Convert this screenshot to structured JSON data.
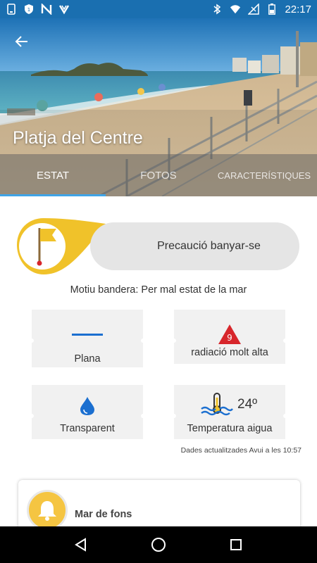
{
  "status_bar": {
    "time": "22:17",
    "left_icons": [
      "phone-icon",
      "shield-icon",
      "n-icon",
      "check-icon"
    ],
    "right_icons": [
      "bluetooth-icon",
      "wifi-icon",
      "signal-icon",
      "battery-icon"
    ]
  },
  "header": {
    "title": "Platja del Centre",
    "back_icon": "arrow-left-icon"
  },
  "tabs": [
    {
      "label": "ESTAT",
      "active": true
    },
    {
      "label": "FOTOS",
      "active": false
    },
    {
      "label": "CARACTERÍSTIQUES",
      "active": false
    }
  ],
  "flag": {
    "status": "Precaució banyar-se",
    "reason": "Motiu bandera: Per mal estat de la mar",
    "flag_color": "#f0c22a"
  },
  "cards": {
    "sea_state": {
      "label": "Plana",
      "icon": "flat-sea-icon"
    },
    "uv": {
      "label": "radiació molt alta",
      "value": "9",
      "icon": "uv-warning-icon",
      "color": "#d7262b"
    },
    "water_clarity": {
      "label": "Transparent",
      "icon": "water-drop-icon"
    },
    "water_temp": {
      "label": "Temperatura aigua",
      "value": "24º",
      "icon": "thermometer-waves-icon"
    }
  },
  "updated": "Dades actualitzades Avui a les 10:57",
  "alert": {
    "title": "Mar de fons",
    "icon": "bell-icon"
  },
  "nav": {
    "back": "back-triangle-icon",
    "home": "home-circle-icon",
    "recents": "recents-square-icon"
  },
  "colors": {
    "status_bar": "#1a6fb0",
    "accent": "#3fa5e8",
    "flag_yellow": "#f0c22a",
    "water_blue": "#1b6fd0"
  }
}
